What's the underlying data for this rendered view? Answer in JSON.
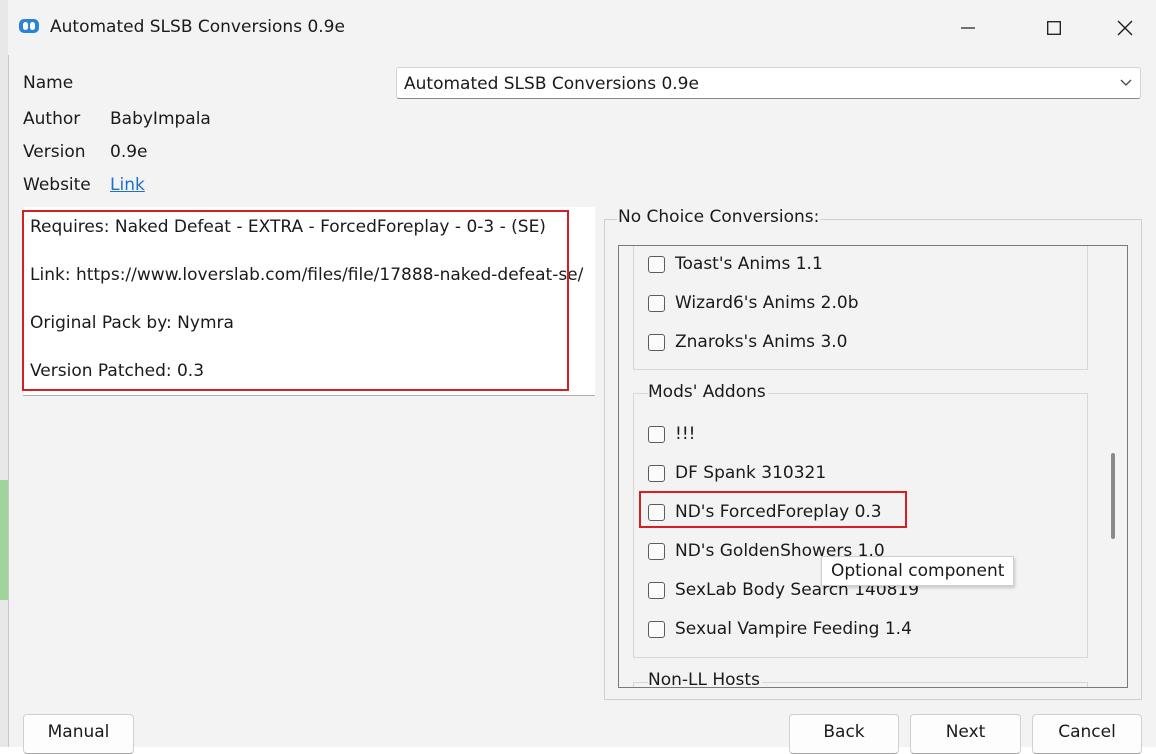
{
  "window": {
    "title": "Automated SLSB Conversions 0.9e",
    "icons": {
      "app": "app-icon",
      "minimize": "minimize-icon",
      "maximize": "maximize-icon",
      "close": "close-icon"
    }
  },
  "info": {
    "name_label": "Name",
    "name_value": "Automated SLSB Conversions 0.9e",
    "author_label": "Author",
    "author_value": "BabyImpala",
    "version_label": "Version",
    "version_value": "0.9e",
    "website_label": "Website",
    "website_value": "Link"
  },
  "description": {
    "lines": [
      "Requires: Naked Defeat - EXTRA - ForcedForeplay - 0-3 - (SE)",
      "Link: https://www.loverslab.com/files/file/17888-naked-defeat-se/",
      "Original Pack by: Nymra",
      "Version Patched: 0.3"
    ]
  },
  "options": {
    "group_title": "No Choice Conversions:",
    "group1_items": [
      "Toast's Anims 1.1",
      "Wizard6's Anims 2.0b",
      "Znaroks's Anims 3.0"
    ],
    "group2_title": "Mods' Addons",
    "group2_items": [
      "!!!",
      "DF Spank 310321",
      "ND's ForcedForeplay 0.3",
      "ND's GoldenShowers 1.0",
      "SexLab Body Search 140819",
      "Sexual Vampire Feeding 1.4"
    ],
    "group3_title": "Non-LL Hosts"
  },
  "tooltip": "Optional component",
  "buttons": {
    "manual": "Manual",
    "back": "Back",
    "next": "Next",
    "cancel": "Cancel"
  },
  "colors": {
    "accent": "#1a73c8",
    "highlight": "#d42020"
  }
}
